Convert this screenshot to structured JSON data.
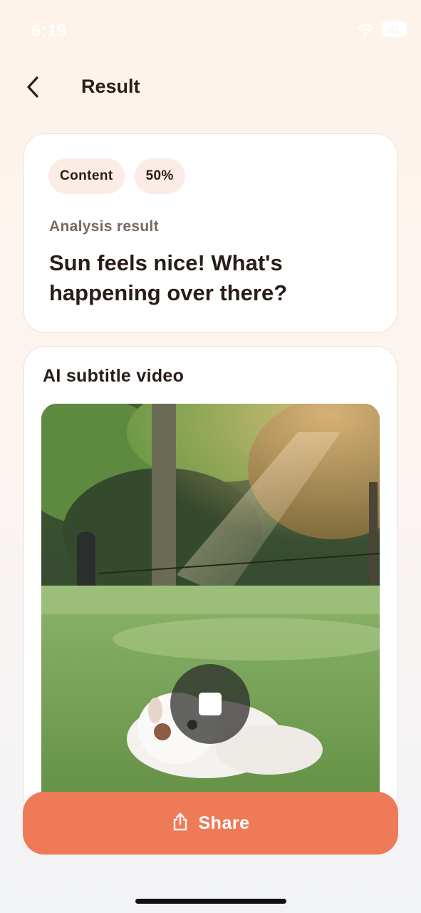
{
  "status_bar": {
    "time": "6:19",
    "battery": "81"
  },
  "header": {
    "title": "Result"
  },
  "result_card": {
    "chips": [
      "Content",
      "50%"
    ],
    "analysis_label": "Analysis result",
    "analysis_text": "Sun feels nice! What's happening over there?"
  },
  "video_card": {
    "title": "AI subtitle video"
  },
  "share_button": {
    "label": "Share"
  },
  "colors": {
    "accent": "#ef7a57",
    "chip_bg": "#fbede5",
    "card_border": "#f3dfd4"
  },
  "icons": [
    "wifi-icon",
    "battery-icon",
    "back-icon",
    "stop-icon",
    "share-icon"
  ]
}
